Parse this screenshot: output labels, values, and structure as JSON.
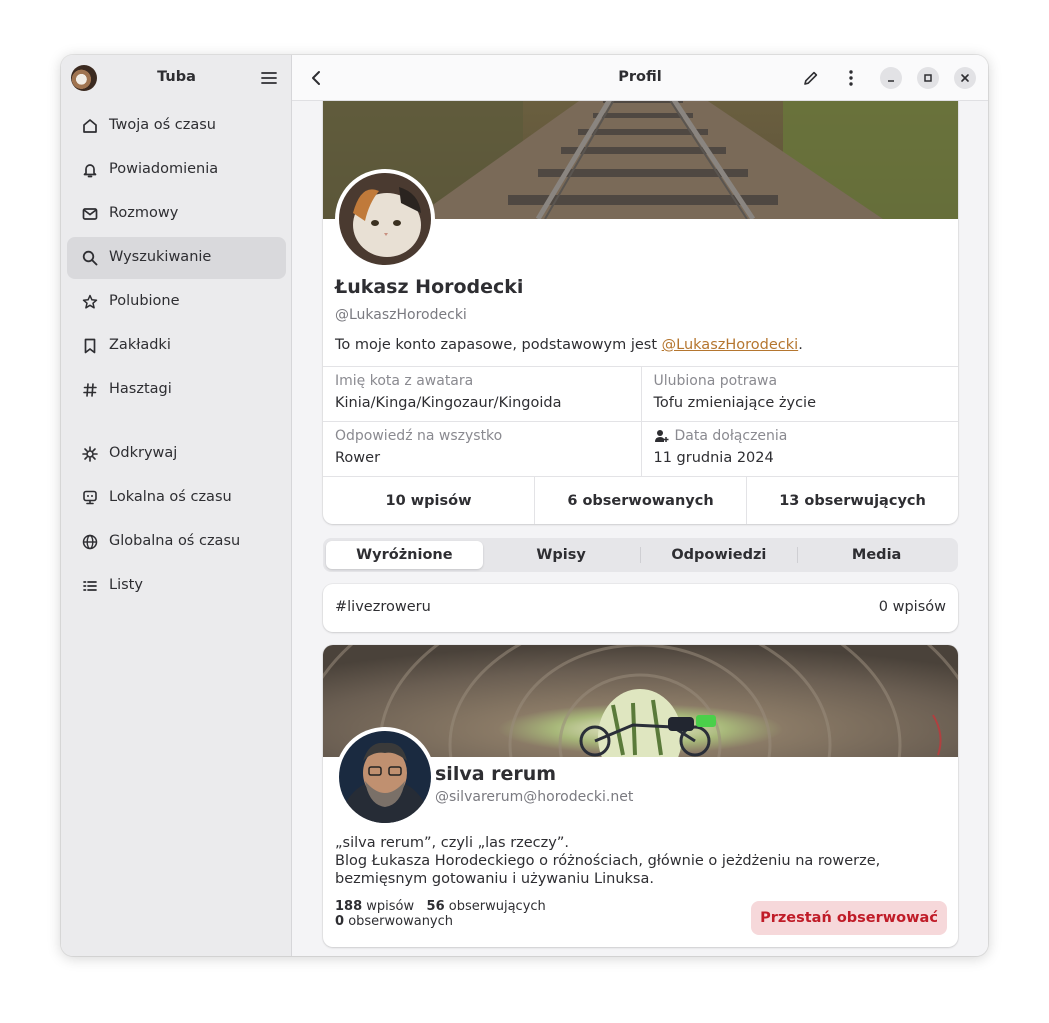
{
  "sidebar": {
    "title": "Tuba",
    "items": [
      {
        "label": "Twoja oś czasu",
        "icon": "home-icon"
      },
      {
        "label": "Powiadomienia",
        "icon": "bell-icon"
      },
      {
        "label": "Rozmowy",
        "icon": "mail-icon"
      },
      {
        "label": "Wyszukiwanie",
        "icon": "search-icon"
      },
      {
        "label": "Polubione",
        "icon": "star-icon"
      },
      {
        "label": "Zakładki",
        "icon": "bookmark-icon"
      },
      {
        "label": "Hasztagi",
        "icon": "hashtag-icon"
      },
      {
        "label": "Odkrywaj",
        "icon": "explore-icon"
      },
      {
        "label": "Lokalna oś czasu",
        "icon": "local-timeline-icon"
      },
      {
        "label": "Globalna oś czasu",
        "icon": "globe-icon"
      },
      {
        "label": "Listy",
        "icon": "list-icon"
      }
    ],
    "active_index": 3
  },
  "header": {
    "title": "Profil"
  },
  "profile": {
    "name": "Łukasz Horodecki",
    "handle": "@LukaszHorodecki",
    "bio_prefix": "To moje konto zapasowe, podstawowym jest ",
    "bio_link": "@LukaszHorodecki",
    "bio_suffix": ".",
    "fields": [
      {
        "label": "Imię kota z awatara",
        "value": "Kinia/Kinga/Kingozaur/Kingoida"
      },
      {
        "label": "Ulubiona potrawa",
        "value": "Tofu zmieniające życie"
      },
      {
        "label": "Odpowiedź na wszystko",
        "value": "Rower"
      },
      {
        "label": "Data dołączenia",
        "value": "11 grudnia 2024"
      }
    ],
    "stats": {
      "posts": "10 wpisów",
      "following": "6 obserwowanych",
      "followers": "13 obserwujących"
    }
  },
  "tabs": [
    "Wyróżnione",
    "Wpisy",
    "Odpowiedzi",
    "Media"
  ],
  "hashtag": {
    "name": "#livezroweru",
    "count": "0 wpisów"
  },
  "account": {
    "name": "silva rerum",
    "handle": "@silvarerum@horodecki.net",
    "bio_line1": "„silva rerum”, czyli „las rzeczy”.",
    "bio_line2": "Blog Łukasza Horodeckiego o różnościach, głównie o jeżdżeniu na rowerze, bezmięsnym gotowaniu i używaniu Linuksa.",
    "posts_num": "188",
    "posts_label": "wpisów",
    "followers_num": "56",
    "followers_label": "obserwujących",
    "following_num": "0",
    "following_label": "obserwowanych",
    "unfollow_label": "Przestań obserwować"
  }
}
